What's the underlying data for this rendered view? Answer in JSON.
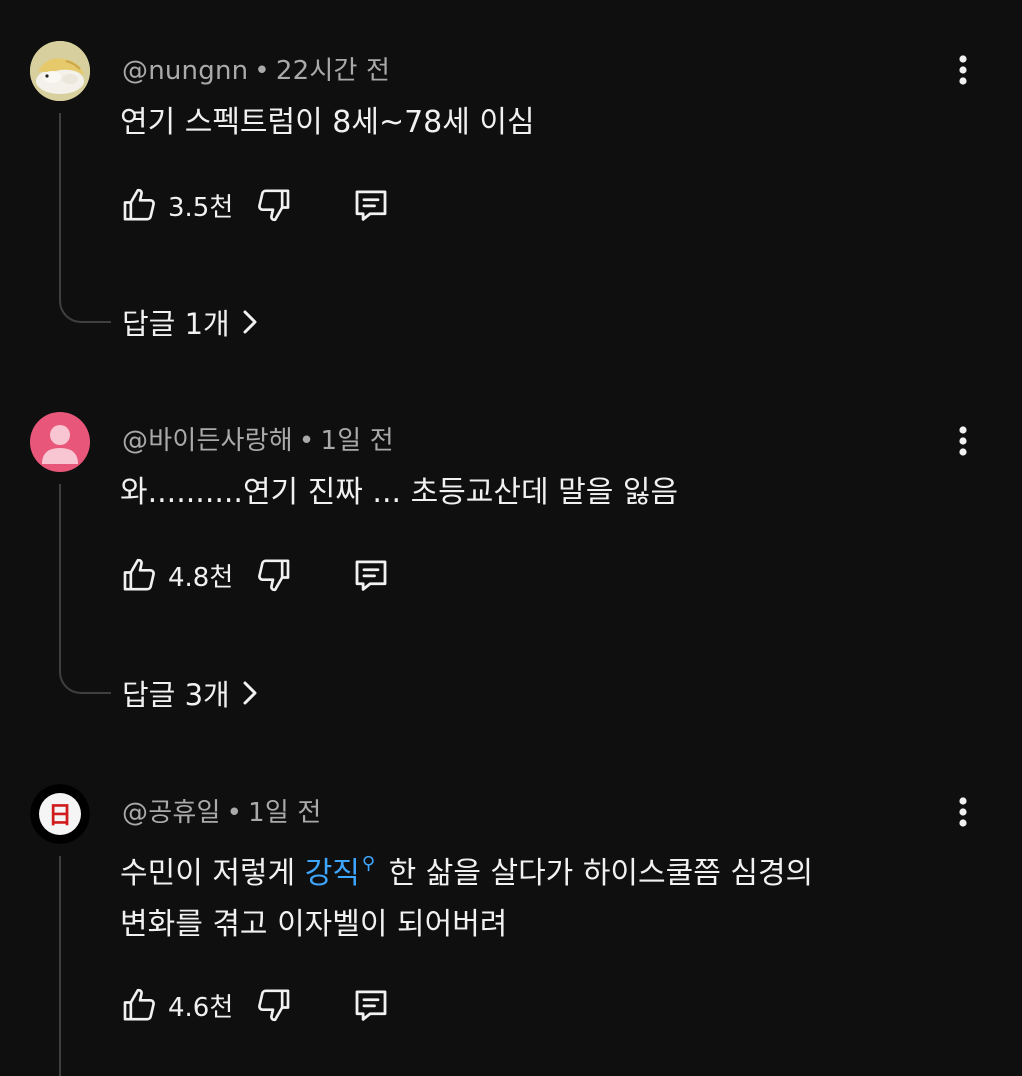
{
  "comments": [
    {
      "handle": "@nungnn",
      "time": "22시간 전",
      "text_lines": [
        "연기 스펙트럼이 8세~78세 이심"
      ],
      "likes": "3.5천",
      "replies_label": "답글 1개",
      "avatar": "hamster-photo"
    },
    {
      "handle": "@바이든사랑해",
      "time": "1일 전",
      "text_lines": [
        "와..........연기 진짜 ... 초등교산데 말을 잃음"
      ],
      "likes": "4.8천",
      "replies_label": "답글 3개",
      "avatar": "default-person",
      "avatar_color": "#e8577a"
    },
    {
      "handle": "@공휴일",
      "time": "1일 전",
      "text_before_link": "수민이 저렇게 ",
      "link_text": "강직",
      "text_after_link": " 한 삶을 살다가 하이스쿨쯤 심경의",
      "text_line2": "변화를 겪고 이자벨이 되어버려",
      "likes": "4.6천",
      "avatar": "holiday-calendar",
      "avatar_glyph": "日"
    }
  ],
  "separator": "•",
  "icons": {
    "like": "thumbs-up-icon",
    "dislike": "thumbs-down-icon",
    "reply": "comment-icon",
    "more": "more-vertical-icon",
    "chevron": "chevron-right-icon"
  }
}
